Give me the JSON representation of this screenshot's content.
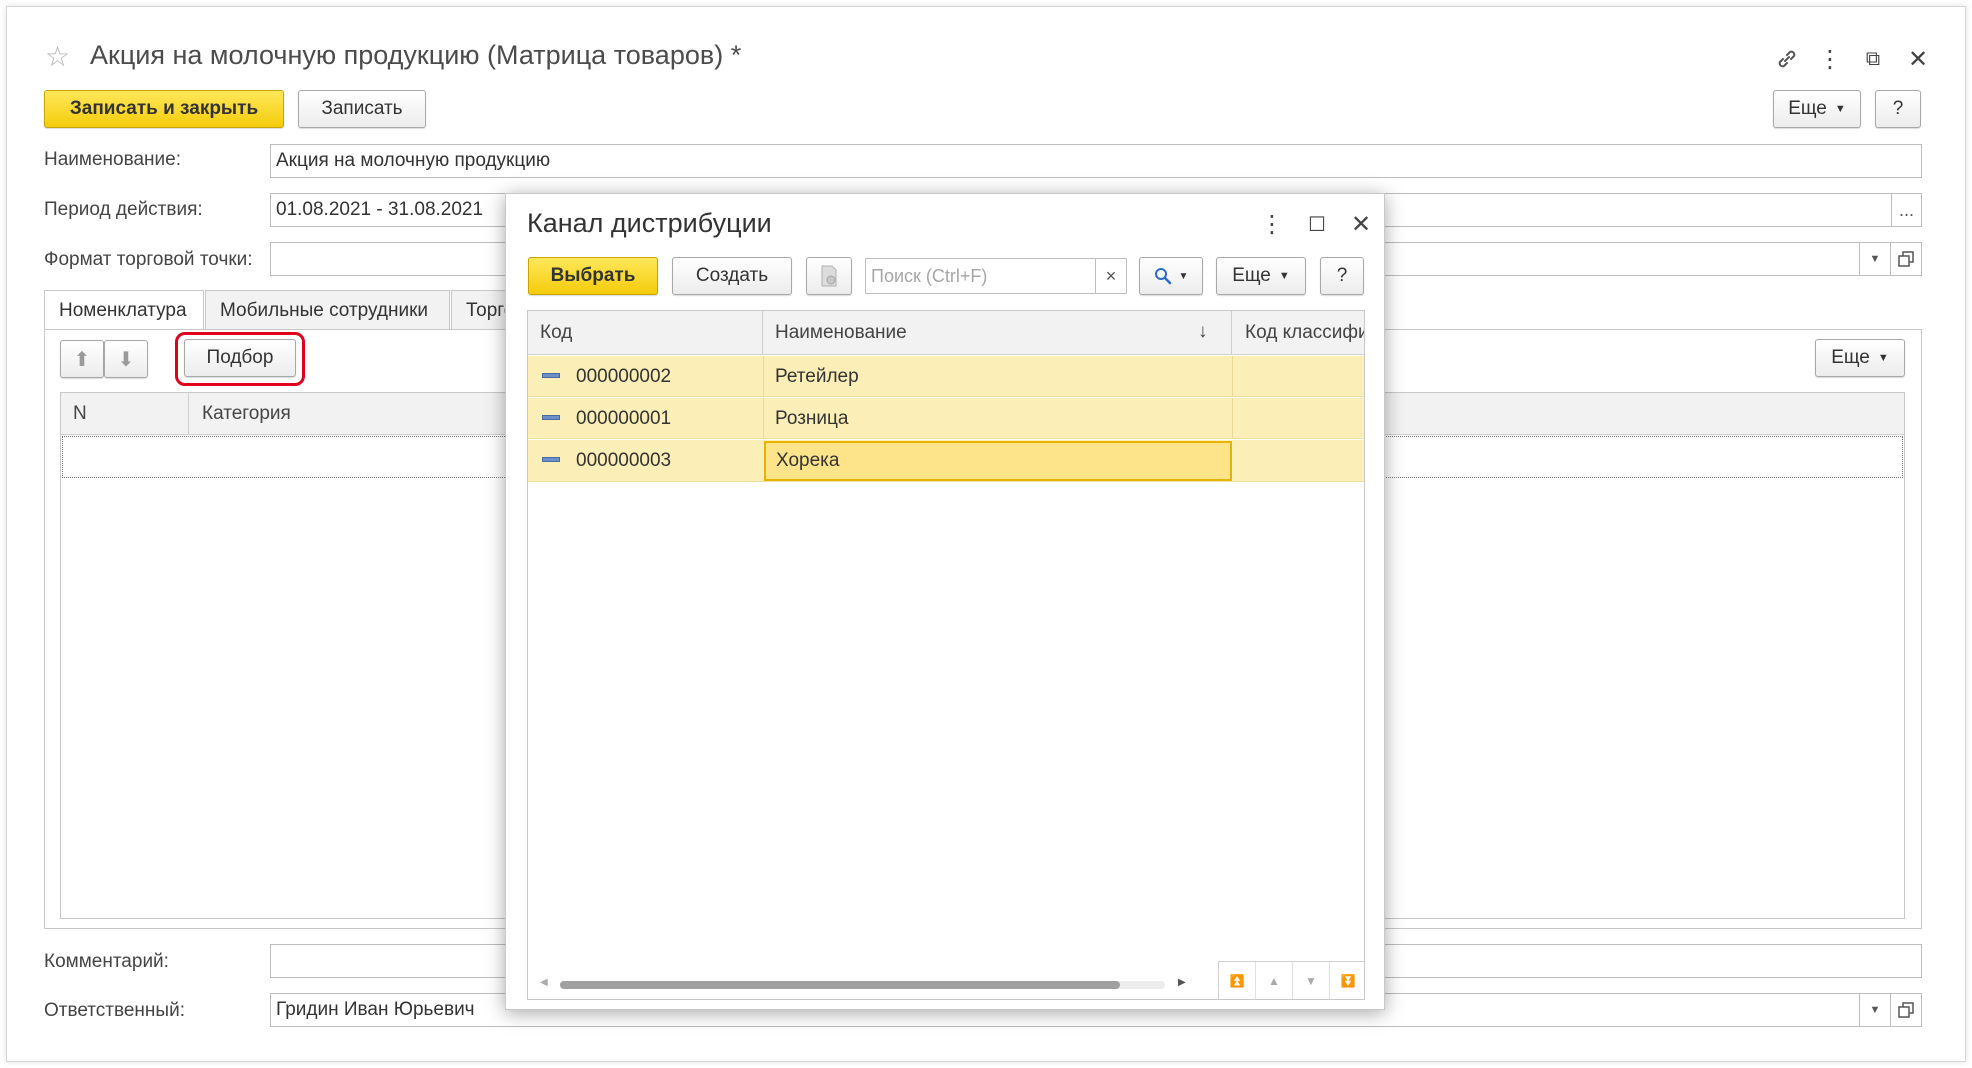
{
  "window": {
    "title": "Акция на молочную продукцию (Матрица товаров) *",
    "star_icon": "☆",
    "link_icon": "🔗",
    "more_icon": "⋮",
    "restore_icon": "⧉",
    "close_icon": "✕"
  },
  "toolbar": {
    "save_close_label": "Записать и закрыть",
    "save_label": "Записать",
    "more_label": "Еще",
    "help_label": "?"
  },
  "form": {
    "name_label": "Наименование:",
    "name_value": "Акция на молочную продукцию",
    "period_label": "Период действия:",
    "period_value": "01.08.2021 - 31.08.2021",
    "period_button": "...",
    "format_label": "Формат торговой точки:",
    "format_value": "",
    "comment_label": "Комментарий:",
    "comment_value": "",
    "responsible_label": "Ответственный:",
    "responsible_value": "Гридин Иван Юрьевич"
  },
  "tabs": [
    {
      "label": "Номенклатура"
    },
    {
      "label": "Мобильные сотрудники"
    },
    {
      "label": "Торго"
    }
  ],
  "table_toolbar": {
    "up_icon": "⬆",
    "down_icon": "⬇",
    "pick_label": "Подбор",
    "more_label": "Еще"
  },
  "table": {
    "columns": [
      "N",
      "Категория"
    ]
  },
  "dialog": {
    "title": "Канал дистрибуции",
    "more_icon": "⋮",
    "maximize_icon": "☐",
    "close_icon": "✕",
    "select_label": "Выбрать",
    "create_label": "Создать",
    "search_placeholder": "Поиск (Ctrl+F)",
    "clear_icon": "×",
    "search_icon": "🔍",
    "more_label": "Еще",
    "help_label": "?",
    "columns": [
      "Код",
      "Наименование",
      "Код классифи"
    ],
    "sort_icon": "↓",
    "rows": [
      {
        "code": "000000002",
        "name": "Ретейлер",
        "class_code": ""
      },
      {
        "code": "000000001",
        "name": "Розница",
        "class_code": ""
      },
      {
        "code": "000000003",
        "name": "Хорека",
        "class_code": ""
      }
    ]
  },
  "colors": {
    "accent_yellow": "#f4cc0b",
    "row_highlight": "#fbeeb6",
    "selected_cell": "#fde48a",
    "pick_outline": "#e0001b"
  }
}
